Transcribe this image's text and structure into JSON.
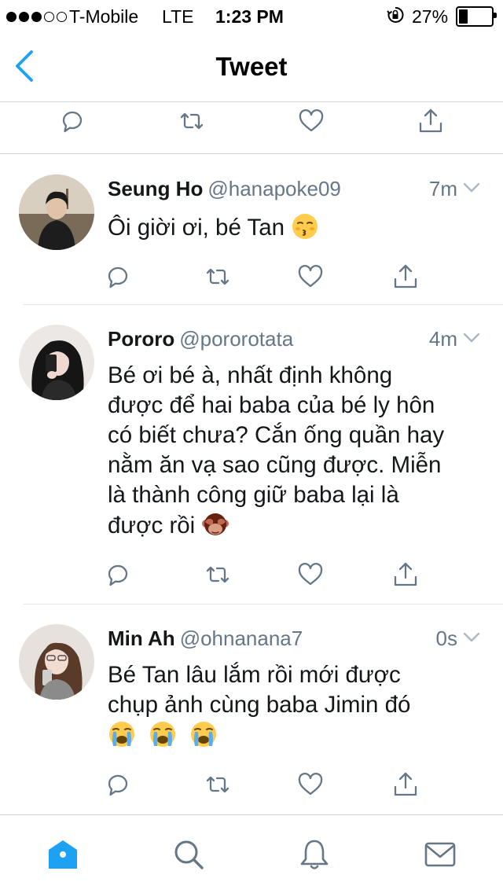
{
  "status_bar": {
    "carrier": "T-Mobile",
    "network": "LTE",
    "time": "1:23 PM",
    "battery_percent": "27%",
    "battery_level": 0.27,
    "signal_bars_filled": 3,
    "signal_bars_total": 5
  },
  "nav": {
    "title": "Tweet"
  },
  "colors": {
    "accent": "#1da1f2",
    "action_icon": "#657786",
    "divider": "#e1e8ed"
  },
  "replies": [
    {
      "name": "Seung Ho",
      "handle": "@hanapoke09",
      "timestamp": "7m",
      "text": "Ôi giời ơi, bé Tan",
      "emojis": [
        "kissing-closed-eyes-emoji"
      ]
    },
    {
      "name": "Pororo",
      "handle": "@pororotata",
      "timestamp": "4m",
      "text_lines": [
        "Bé ơi bé à, nhất định không",
        "được để hai baba của bé ly hôn",
        "có biết chưa? Cắn ống quần hay",
        "nằm ăn vạ sao cũng được. Miễn",
        "là thành công giữ baba lại là",
        "được rồi"
      ],
      "emojis": [
        "see-no-evil-monkey-emoji"
      ]
    },
    {
      "name": "Min Ah",
      "handle": "@ohnanana7",
      "timestamp": "0s",
      "text_lines": [
        "Bé Tan lâu lắm rồi mới được",
        "chụp ảnh cùng baba Jimin đó"
      ],
      "emojis": [
        "loudly-crying-emoji",
        "loudly-crying-emoji",
        "loudly-crying-emoji"
      ]
    }
  ],
  "tabs": [
    {
      "icon": "home-icon",
      "active": true
    },
    {
      "icon": "search-icon",
      "active": false
    },
    {
      "icon": "bell-icon",
      "active": false
    },
    {
      "icon": "mail-icon",
      "active": false
    }
  ]
}
